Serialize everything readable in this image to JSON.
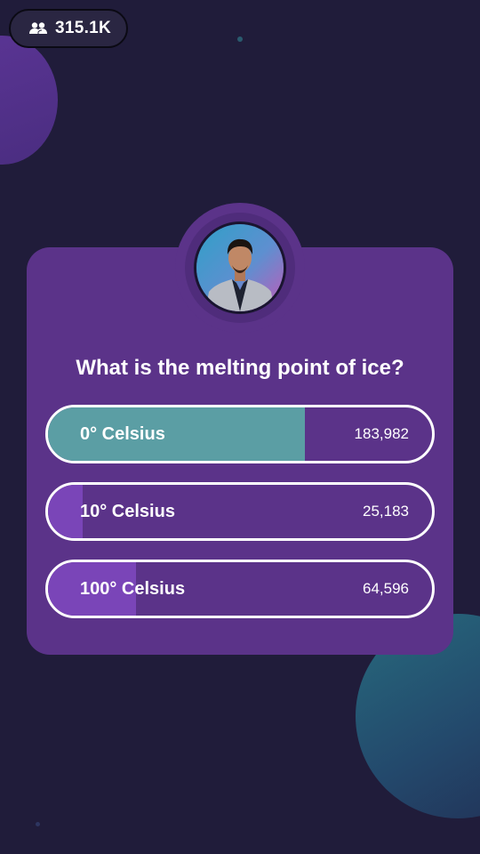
{
  "viewer_count": {
    "icon": "users-icon",
    "value": "315.1K"
  },
  "host": {
    "avatar_icon": "host-avatar-photo"
  },
  "question": "What is the melting point of ice?",
  "options": [
    {
      "label": "0° Celsius",
      "votes": "183,982",
      "fill_fraction": 0.67,
      "fill_color": "#5b9ea4"
    },
    {
      "label": "10° Celsius",
      "votes": "25,183",
      "fill_fraction": 0.09,
      "fill_color": "#7a45b8"
    },
    {
      "label": "100° Celsius",
      "votes": "64,596",
      "fill_fraction": 0.23,
      "fill_color": "#7a45b8"
    }
  ],
  "colors": {
    "background": "#201c3a",
    "card": "#5b3389",
    "correct_fill": "#5b9ea4",
    "other_fill": "#7a45b8"
  }
}
